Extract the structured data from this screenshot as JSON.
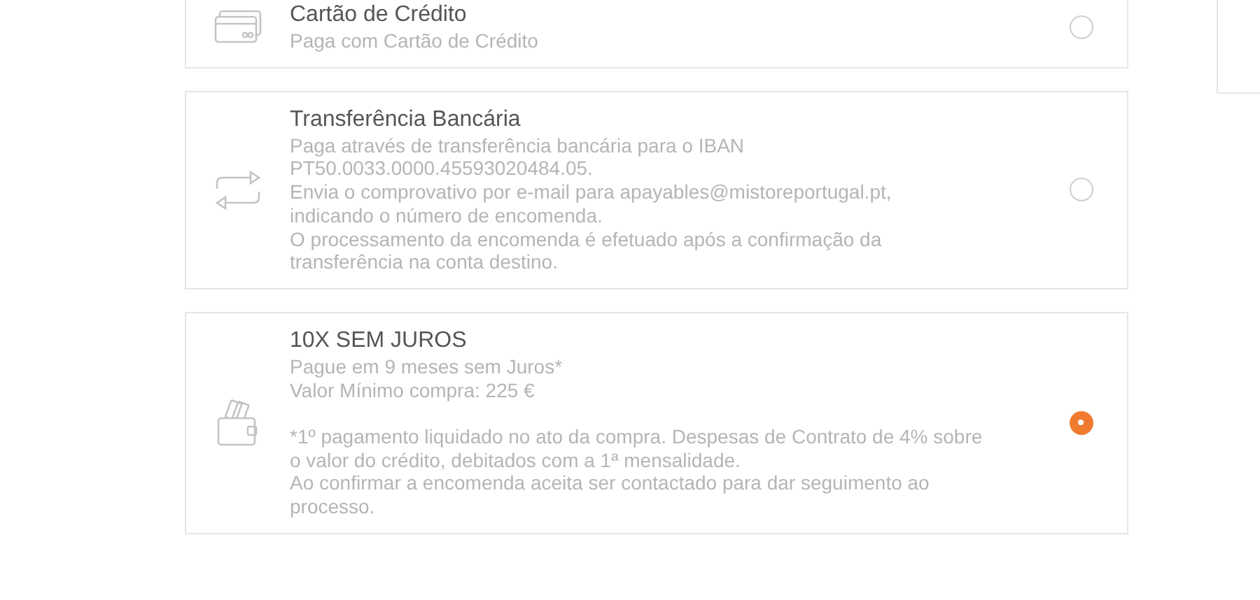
{
  "payment_methods": [
    {
      "kind": "card",
      "title": "Cartão de Crédito",
      "description": [
        [
          "Paga com Cartão de Crédito"
        ]
      ],
      "selected": false
    },
    {
      "kind": "transfer",
      "title": "Transferência Bancária",
      "description": [
        [
          "Paga através de transferência bancária para o IBAN",
          "PT50.0033.0000.45593020484.05.",
          "Envia o comprovativo por e-mail para apayables@mistoreportugal.pt,",
          "indicando o número de encomenda.",
          "O processamento da encomenda é efetuado após a confirmação da",
          "transferência na conta destino."
        ]
      ],
      "selected": false
    },
    {
      "kind": "wallet",
      "title": "10X SEM JUROS",
      "description": [
        [
          "Pague em 9 meses sem Juros*",
          "Valor Mínimo compra: 225 €"
        ],
        [
          "*1º pagamento liquidado no ato da compra. Despesas de Contrato de 4% sobre",
          "o valor do crédito, debitados com a 1ª mensalidade.",
          "Ao confirmar a encomenda aceita ser contactado para dar seguimento ao",
          "processo."
        ]
      ],
      "selected": true
    }
  ]
}
